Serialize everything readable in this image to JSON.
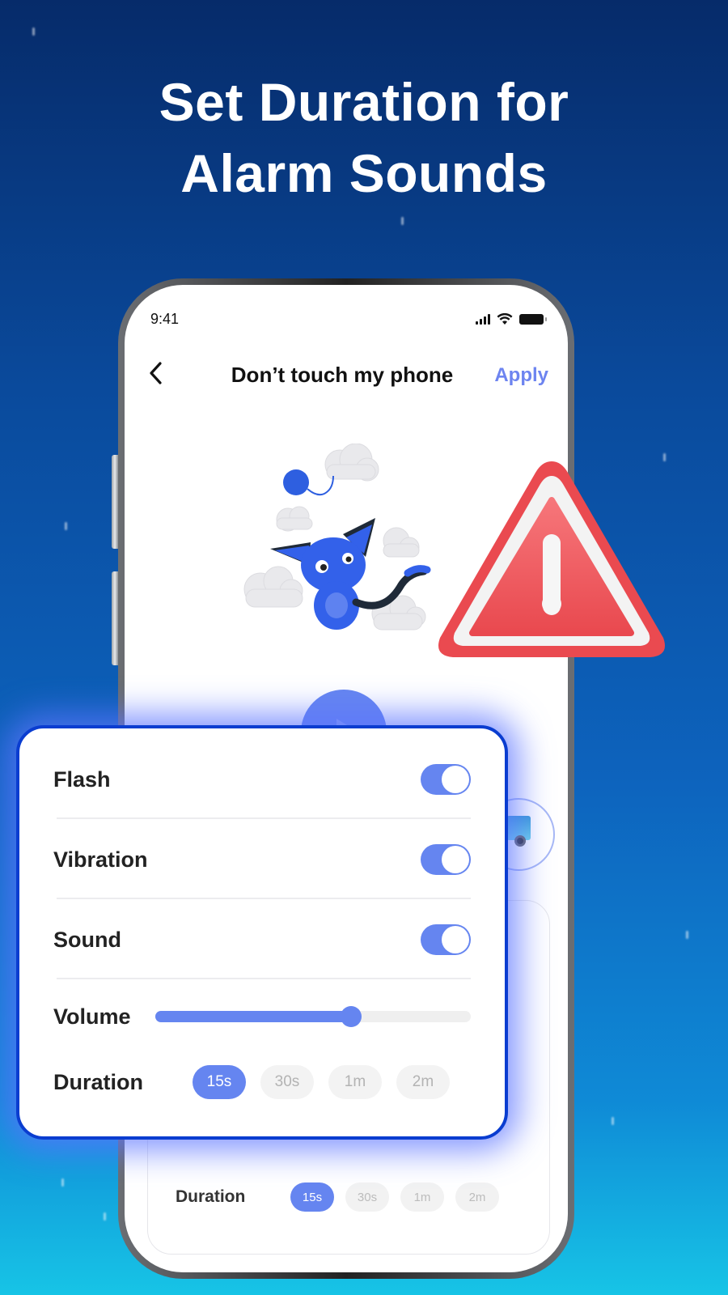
{
  "headline": {
    "line1": "Set Duration for",
    "line2": "Alarm Sounds"
  },
  "phone": {
    "status_bar": {
      "time": "9:41",
      "icons": [
        "signal-icon",
        "wifi-icon",
        "battery-icon"
      ]
    },
    "nav": {
      "back_icon": "chevron-left-icon",
      "title": "Don’t touch my phone",
      "apply_label": "Apply"
    },
    "illustration": "blue-cat-with-yarn-ball-and-clouds",
    "play_button_icon": "play-icon",
    "theme_option_icon": "truck-icon",
    "inner_duration": {
      "label": "Duration",
      "options": [
        "15s",
        "30s",
        "1m",
        "2m"
      ],
      "selected": "15s"
    }
  },
  "warning_icon": "warning-triangle-icon",
  "settings": {
    "toggles": [
      {
        "label": "Flash",
        "on": true
      },
      {
        "label": "Vibration",
        "on": true
      },
      {
        "label": "Sound",
        "on": true
      }
    ],
    "volume": {
      "label": "Volume",
      "value_percent": 62
    },
    "duration": {
      "label": "Duration",
      "options": [
        "15s",
        "30s",
        "1m",
        "2m"
      ],
      "selected": "15s"
    }
  },
  "colors": {
    "accent": "#6585f0",
    "card_border": "#0a3dd0",
    "warning": "#f05a5e"
  }
}
